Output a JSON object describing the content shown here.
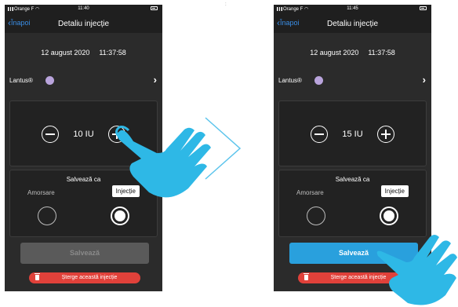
{
  "separator_mark": ":",
  "screens": {
    "before": {
      "status": {
        "carrier": "Orange F",
        "time": "11:40"
      },
      "nav": {
        "back_label": "Înapoi",
        "title": "Detaliu injecție"
      },
      "date": "12 august 2020",
      "time": "11:37:58",
      "medication": {
        "name": "Lantus®",
        "color": "#b9a4dc"
      },
      "dose": "10 IU",
      "save_as": {
        "label": "Salvează ca",
        "option_prime": "Amorsare",
        "option_injection": "Injecție",
        "selected": "Injecție"
      },
      "save_button": {
        "label": "Salvează",
        "state": "disabled"
      },
      "delete_button": {
        "label": "Șterge această injecție"
      }
    },
    "after": {
      "status": {
        "carrier": "Orange F",
        "time": "11:45"
      },
      "nav": {
        "back_label": "Înapoi",
        "title": "Detaliu injecție"
      },
      "date": "12 august 2020",
      "time": "11:37:58",
      "medication": {
        "name": "Lantus®",
        "color": "#b9a4dc"
      },
      "dose": "15 IU",
      "save_as": {
        "label": "Salvează ca",
        "option_prime": "Amorsare",
        "option_injection": "Injecție",
        "selected": "Injecție"
      },
      "save_button": {
        "label": "Salvează",
        "state": "active"
      },
      "delete_button": {
        "label": "Șterge această injecție"
      }
    }
  },
  "colors": {
    "accent_blue": "#29a0dd",
    "link_blue": "#3a8ee6",
    "delete_red": "#e0413a",
    "hand_blue": "#2eb8e6",
    "arrow_blue": "#5bc4ec"
  },
  "icons": [
    "back-chevron-icon",
    "minus-icon",
    "plus-icon",
    "chevron-right-icon",
    "trash-icon",
    "pointing-hand-icon",
    "next-arrow-icon"
  ]
}
